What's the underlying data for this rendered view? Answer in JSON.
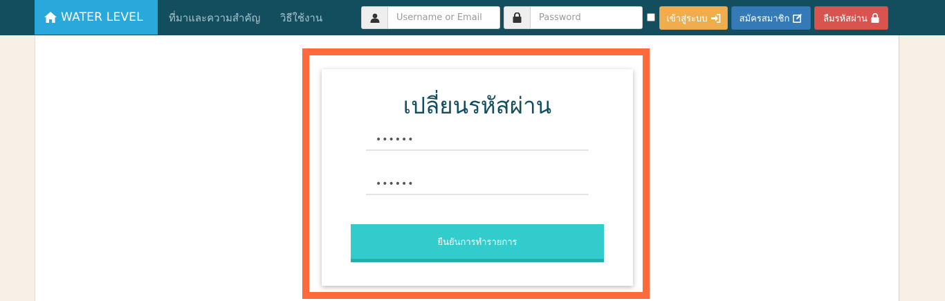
{
  "navbar": {
    "brand": "WATER LEVEL",
    "links": [
      "ที่มาและความสำคัญ",
      "วิธีใช้งาน"
    ],
    "username_placeholder": "Username or Email",
    "password_placeholder": "Password",
    "login_label": "เข้าสู่ระบบ",
    "register_label": "สมัครสมาชิก",
    "forgot_label": "ลืมรหัสผ่าน"
  },
  "form": {
    "title": "เปลี่ยนรหัสผ่าน",
    "new_password_value": "••••••",
    "confirm_password_value": "••••••",
    "submit_label": "ยืนยันการทำรายการ"
  },
  "colors": {
    "navbar": "#134e5e",
    "brand": "#29a8dc",
    "login_button": "#f0ad4e",
    "register_button": "#337ab7",
    "forgot_button": "#d9534f",
    "highlight_border": "#ff6a3d",
    "submit_button": "#33cccc"
  },
  "icons": {
    "brand": "home-icon",
    "username": "user-icon",
    "password": "lock-icon",
    "login": "sign-in-icon",
    "register": "edit-icon",
    "forgot": "lock-icon"
  }
}
